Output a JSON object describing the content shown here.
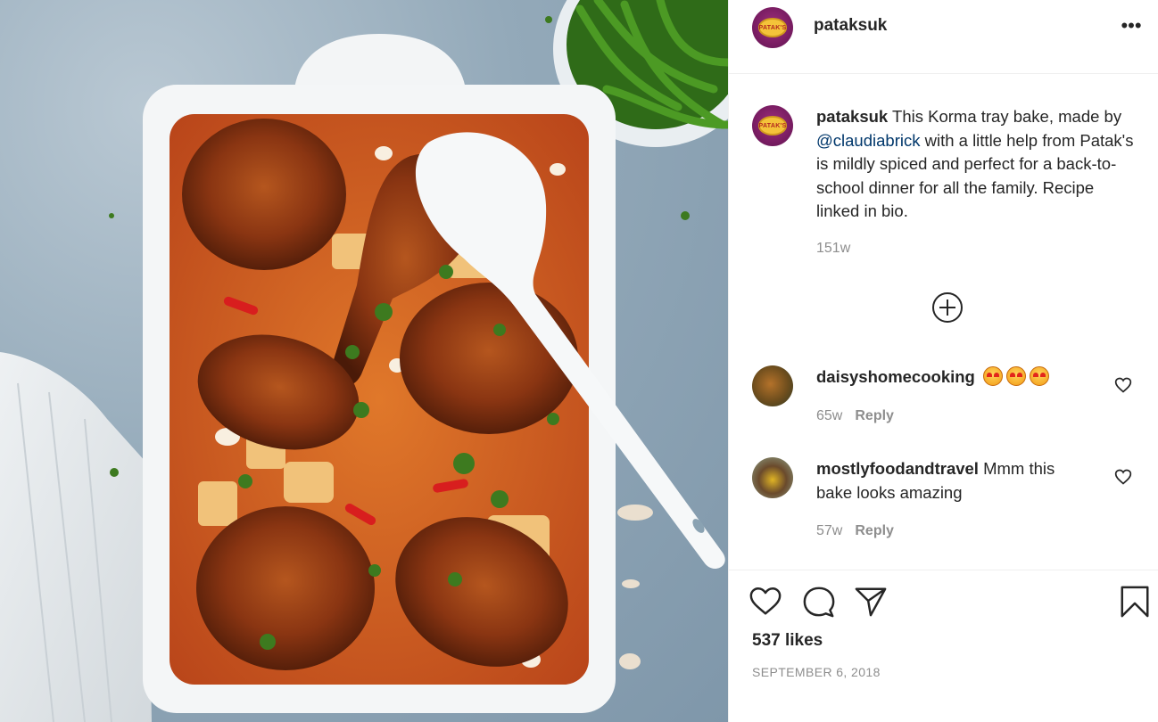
{
  "post": {
    "username": "pataksuk",
    "avatar_badge_text": "PATAK'S",
    "image_subject": "Korma tray bake with roasted chicken, beans and green beans"
  },
  "caption": {
    "username": "pataksuk",
    "text_before_mention": " This Korma tray bake, made by ",
    "mention": "@claudiabrick",
    "text_after_mention": " with a little help from Patak's is mildly spiced and perfect for a back-to-school dinner for all the family. Recipe linked in bio.",
    "time": "151w"
  },
  "comments": [
    {
      "username": "daisyshomecooking",
      "text": "",
      "emoji_count": 3,
      "time": "65w",
      "reply_label": "Reply"
    },
    {
      "username": "mostlyfoodandtravel",
      "text": " Mmm this bake looks amazing",
      "emoji_count": 0,
      "time": "57w",
      "reply_label": "Reply"
    }
  ],
  "actions": {
    "likes": "537 likes",
    "date": "SEPTEMBER 6, 2018"
  },
  "icons": [
    "more-options-icon",
    "load-more-comments-icon",
    "heart-icon",
    "comment-icon",
    "share-icon",
    "save-icon"
  ],
  "colors": {
    "mention": "#00376b",
    "muted": "#8e8e8e",
    "avatar": "#7a1d63"
  }
}
